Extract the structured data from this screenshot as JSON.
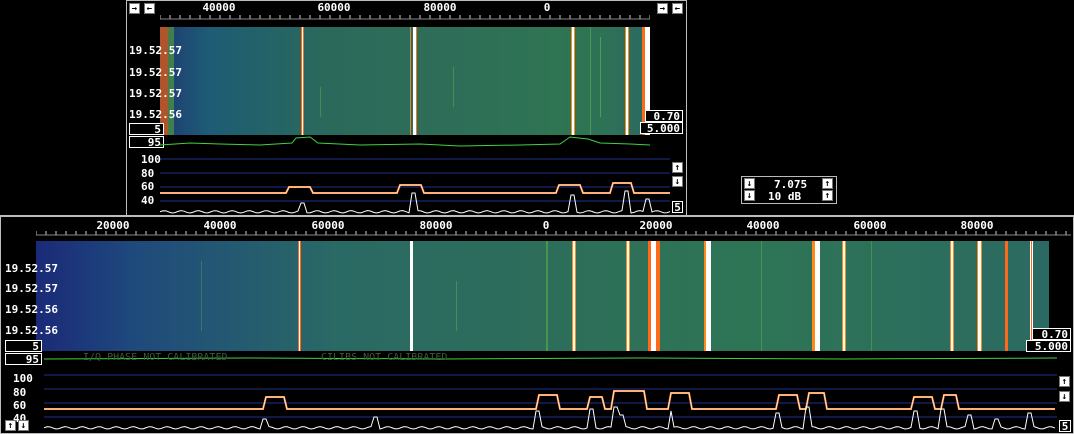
{
  "colors": {
    "green_trace": "#3fd23f",
    "avg_trace": "#ff7a2a",
    "peak_trace": "#ffffff",
    "grid": "#1f2f8c",
    "accent": "#ff9a2a"
  },
  "top": {
    "freq_labels": [
      "40000",
      "60000",
      "80000",
      "0"
    ],
    "time_labels": [
      "19.52.57",
      "19.52.57",
      "19.52.57",
      "19.52.56"
    ],
    "gain_value": "0.70",
    "range_value": "5.000",
    "avg_count": "5",
    "trace_scale": "95",
    "db_labels": [
      "100",
      "80",
      "60",
      "40"
    ],
    "spectrum_count": "5"
  },
  "control": {
    "value1": "7.075",
    "value2": "10 dB"
  },
  "bottom": {
    "freq_labels": [
      "20000",
      "40000",
      "60000",
      "80000",
      "0",
      "20000",
      "40000",
      "60000",
      "80000"
    ],
    "time_labels": [
      "19.52.57",
      "19.52.57",
      "19.52.56",
      "19.52.56"
    ],
    "gain_value": "0.70",
    "range_value": "5.000",
    "avg_count": "5",
    "trace_scale": "95",
    "status_text1": "I/Q PHASE NOT CALIBRATED",
    "status_text2": "CILIBS NOT CALIBRATED",
    "db_labels": [
      "100",
      "80",
      "60",
      "40"
    ],
    "spectrum_count": "5"
  },
  "icons": {
    "scroll_right": "→",
    "scroll_left": "←",
    "arrow_up": "↑",
    "arrow_down": "↓"
  }
}
